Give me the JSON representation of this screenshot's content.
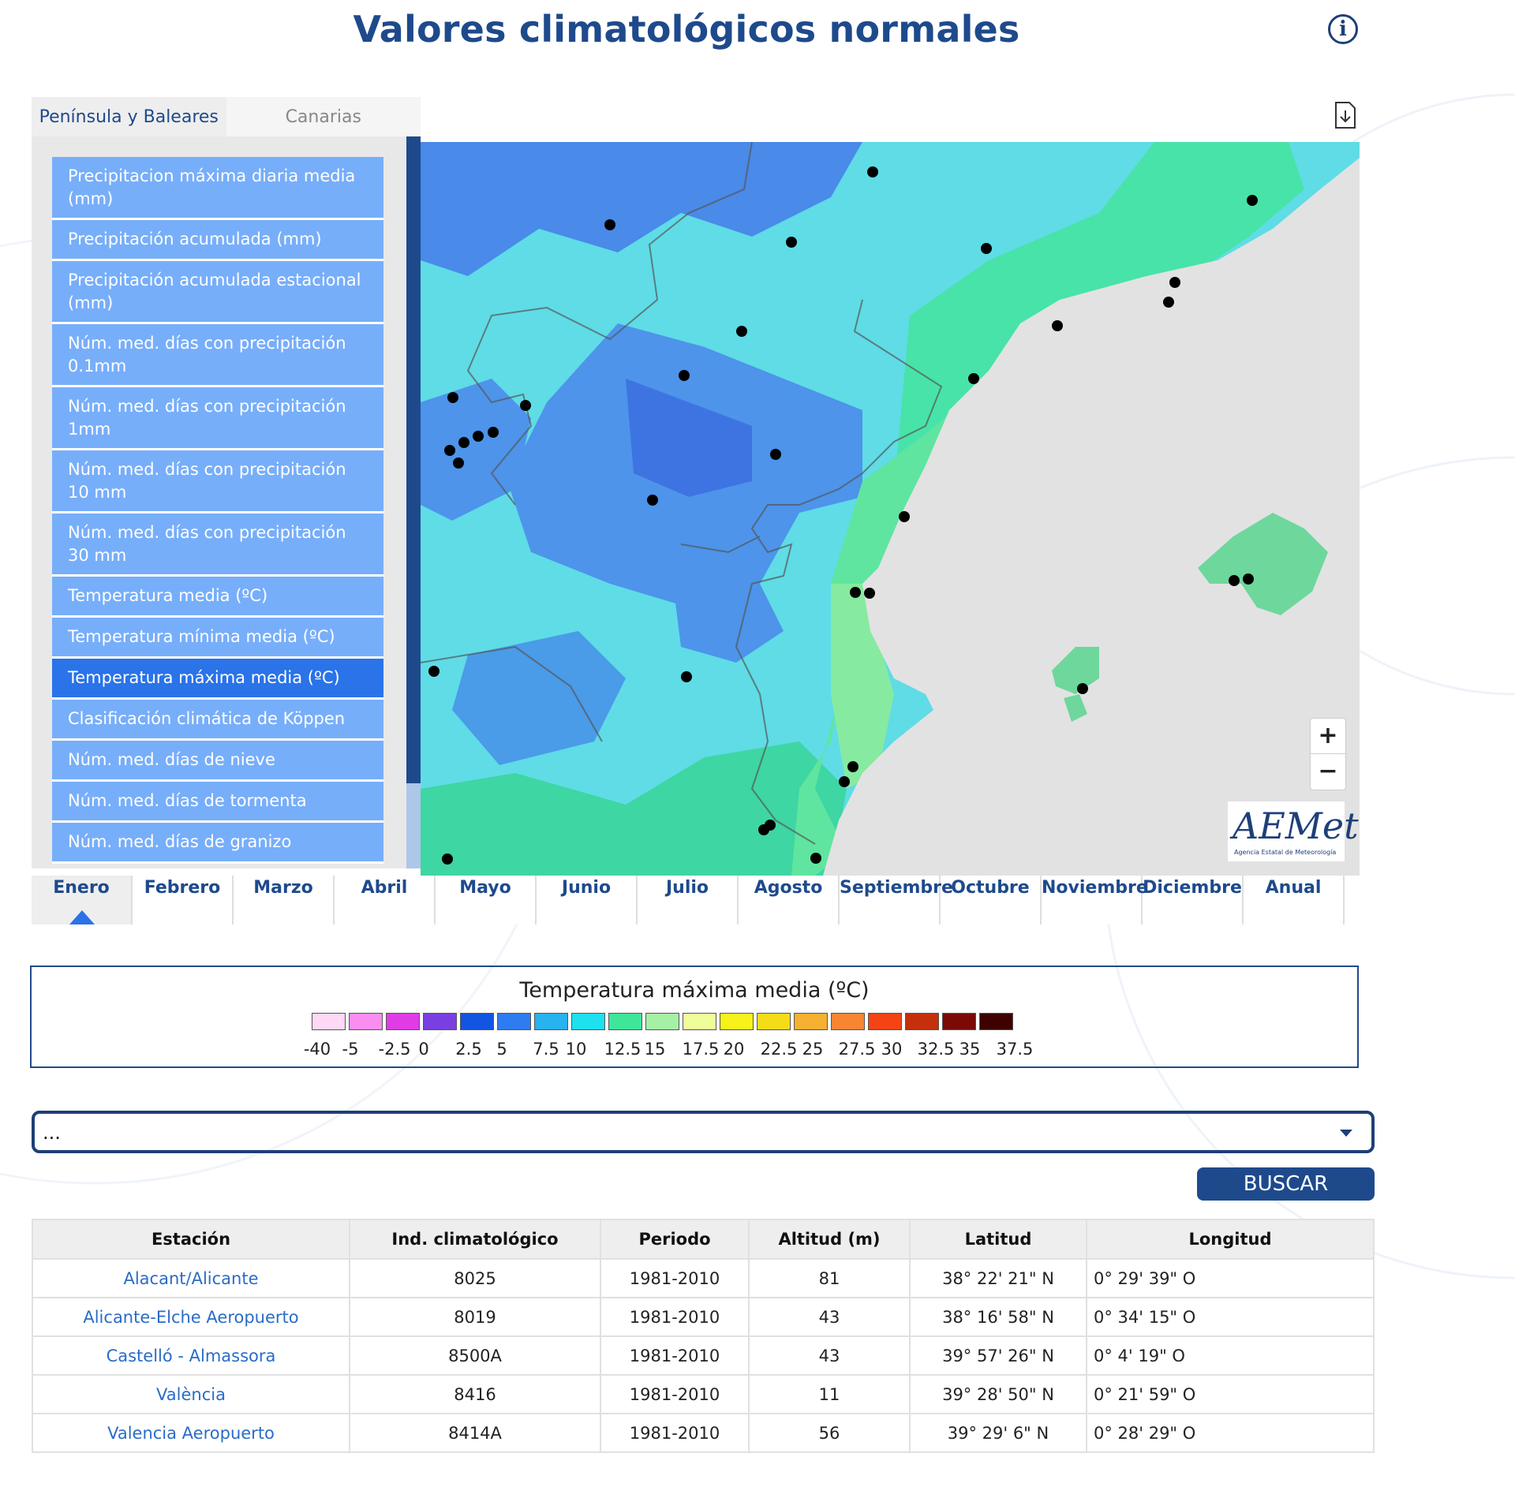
{
  "title": "Valores climatológicos normales",
  "info_icon": "info-icon",
  "region_tabs": [
    {
      "label": "Península y Baleares",
      "active": true
    },
    {
      "label": "Canarias",
      "active": false
    }
  ],
  "variables": [
    {
      "label": "Precipitacion máxima diaria media (mm)",
      "active": false
    },
    {
      "label": "Precipitación acumulada (mm)",
      "active": false
    },
    {
      "label": "Precipitación acumulada estacional (mm)",
      "active": false
    },
    {
      "label": "Núm. med. días con precipitación 0.1mm",
      "active": false
    },
    {
      "label": "Núm. med. días con precipitación 1mm",
      "active": false
    },
    {
      "label": "Núm. med. días con precipitación 10 mm",
      "active": false
    },
    {
      "label": "Núm. med. días con precipitación 30 mm",
      "active": false
    },
    {
      "label": "Temperatura media (ºC)",
      "active": false
    },
    {
      "label": "Temperatura mínima media (ºC)",
      "active": false
    },
    {
      "label": "Temperatura máxima media (ºC)",
      "active": true
    },
    {
      "label": "Clasificación climática de Köppen",
      "active": false
    },
    {
      "label": "Núm. med. días de nieve",
      "active": false
    },
    {
      "label": "Núm. med. días de tormenta",
      "active": false
    },
    {
      "label": "Núm. med. días de granizo",
      "active": false
    }
  ],
  "map": {
    "zoom_in": "+",
    "zoom_out": "−",
    "logo_text": "AEMet",
    "logo_subtitle": "Agencia Estatal de Meteorología",
    "download_icon": "download-icon"
  },
  "months": [
    {
      "label": "Enero",
      "active": true
    },
    {
      "label": "Febrero"
    },
    {
      "label": "Marzo"
    },
    {
      "label": "Abril"
    },
    {
      "label": "Mayo"
    },
    {
      "label": "Junio"
    },
    {
      "label": "Julio"
    },
    {
      "label": "Agosto"
    },
    {
      "label": "Septiembre"
    },
    {
      "label": "Octubre"
    },
    {
      "label": "Noviembre"
    },
    {
      "label": "Diciembre"
    },
    {
      "label": "Anual"
    }
  ],
  "legend": {
    "title": "Temperatura máxima media (ºC)",
    "colors": [
      "#ffd9f5",
      "#f98ef0",
      "#e03ce6",
      "#7a3fe0",
      "#1255e0",
      "#2f7cf0",
      "#27b2f0",
      "#1fe0ee",
      "#3fe69a",
      "#a6f0a6",
      "#eeff99",
      "#f6f21a",
      "#f5dc19",
      "#f7b132",
      "#f88531",
      "#f54414",
      "#c4300c",
      "#7b0a06",
      "#3f0000"
    ],
    "labels": [
      "-40",
      "-5",
      "-2.5",
      "0",
      "2.5",
      "5",
      "7.5",
      "10",
      "12.5",
      "15",
      "17.5",
      "20",
      "22.5",
      "25",
      "27.5",
      "30",
      "32.5",
      "35",
      "37.5"
    ]
  },
  "search": {
    "select_value": "...",
    "button_label": "BUSCAR"
  },
  "table": {
    "headers": [
      "Estación",
      "Ind. climatológico",
      "Periodo",
      "Altitud (m)",
      "Latitud",
      "Longitud"
    ],
    "rows": [
      [
        "Alacant/Alicante",
        "8025",
        "1981-2010",
        "81",
        "38° 22' 21\" N",
        "0° 29' 39\" O"
      ],
      [
        "Alicante-Elche Aeropuerto",
        "8019",
        "1981-2010",
        "43",
        "38° 16' 58\" N",
        "0° 34' 15\" O"
      ],
      [
        "Castelló - Almassora",
        "8500A",
        "1981-2010",
        "43",
        "39° 57' 26\" N",
        "0° 4' 19\" O"
      ],
      [
        "València",
        "8416",
        "1981-2010",
        "11",
        "39° 28' 50\" N",
        "0° 21' 59\" O"
      ],
      [
        "Valencia Aeropuerto",
        "8414A",
        "1981-2010",
        "56",
        "39° 29' 6\" N",
        "0° 28' 29\" O"
      ]
    ]
  }
}
